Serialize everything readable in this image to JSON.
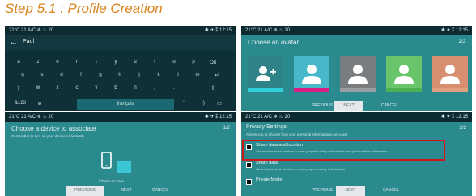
{
  "title": "Step 5.1 : Profile Creation",
  "status": {
    "left": "21°C  21  A/C  ❄  ♨  20",
    "right": "✱  ✈  ⁑  12:15"
  },
  "keyboard_screen": {
    "input_value": "Paul",
    "rows": [
      [
        "a",
        "z",
        "e",
        "r",
        "t",
        "y",
        "u",
        "i",
        "o",
        "p",
        "⌫"
      ],
      [
        "q",
        "s",
        "d",
        "f",
        "g",
        "h",
        "j",
        "k",
        "l",
        "m",
        "↵"
      ],
      [
        "⇧",
        "w",
        "x",
        "c",
        "v",
        "b",
        "n",
        ",",
        ".",
        "",
        "⇧"
      ],
      [
        "&123",
        "⊕",
        "",
        "",
        "",
        "",
        "",
        "'",
        ":)",
        "",
        "▭"
      ]
    ],
    "language_key": "français"
  },
  "avatar_screen": {
    "heading": "Choose an avatar",
    "page": "2/2",
    "buttons": {
      "previous": "PREVIOUS",
      "next": "NEXT",
      "cancel": "CANCEL"
    },
    "avatars": [
      {
        "bg": "#2d8388",
        "strip": "#2fd0d8",
        "icon": "add-user"
      },
      {
        "bg": "#48b7c8",
        "strip": "#d91f86",
        "icon": "user"
      },
      {
        "bg": "#7a7d80",
        "strip": "#9b9ea1",
        "icon": "user"
      },
      {
        "bg": "#69c46a",
        "strip": "#4caf50",
        "icon": "user"
      },
      {
        "bg": "#d88f70",
        "strip": "#e0a080",
        "icon": "user"
      }
    ]
  },
  "bluetooth_screen": {
    "heading": "Choose a device to associate",
    "subheading": "Remember to turn on your device's bluetooth",
    "page": "1/2",
    "device_name": "iPhone de Paul",
    "buttons": {
      "previous": "PREVIOUS",
      "next": "NEXT",
      "cancel": "CANCEL"
    }
  },
  "privacy_screen": {
    "heading": "Privacy Settings",
    "subheading": "Allows you to choose how your personal informations are used",
    "page": "2/2",
    "options": [
      {
        "title": "Share data and location",
        "desc": "Allows authorized services to work properly using vehicle data and your location information",
        "checked": true
      },
      {
        "title": "Share data",
        "desc": "Allows authorized services to work properly using vehicle data",
        "checked": true
      },
      {
        "title": "Private Mode",
        "desc": "",
        "checked": true
      }
    ],
    "buttons": {
      "previous": "PREVIOUS",
      "next": "NEXT",
      "cancel": "CANCEL"
    }
  },
  "colors": {
    "accent": "#d9831a",
    "highlight": "#d01818",
    "screen_bg": "#2a8a8e",
    "statusbar": "#0c2b31"
  }
}
